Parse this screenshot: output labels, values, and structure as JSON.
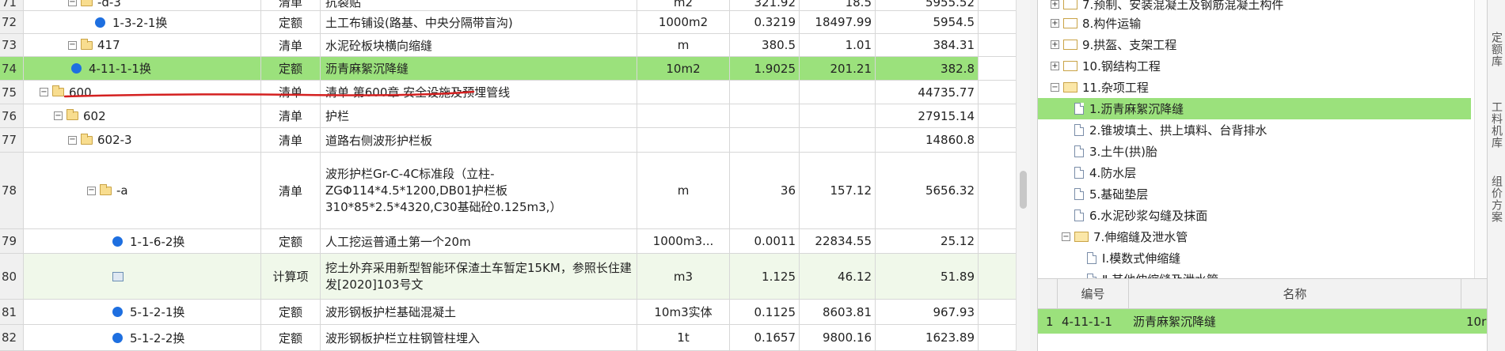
{
  "grid_rows": [
    {
      "num": "71",
      "code": "-d-3",
      "type": "清单",
      "name": "抗裂贴",
      "unit": "m2",
      "qty": "321.92",
      "price": "18.5",
      "total": "5955.52"
    },
    {
      "num": "72",
      "code": "1-3-2-1换",
      "type": "定额",
      "name": "土工布铺设(路基、中央分隔带盲沟)",
      "unit": "1000m2",
      "qty": "0.3219",
      "price": "18497.99",
      "total": "5954.5"
    },
    {
      "num": "73",
      "code": "417",
      "type": "清单",
      "name": "水泥砼板块横向缩缝",
      "unit": "m",
      "qty": "380.5",
      "price": "1.01",
      "total": "384.31"
    },
    {
      "num": "74",
      "code": "4-11-1-1换",
      "type": "定额",
      "name": "沥青麻絮沉降缝",
      "unit": "10m2",
      "qty": "1.9025",
      "price": "201.21",
      "total": "382.8"
    },
    {
      "num": "75",
      "code": "600",
      "type": "清单",
      "name": "清单  第600章  安全设施及预埋管线",
      "unit": "",
      "qty": "",
      "price": "",
      "total": "44735.77"
    },
    {
      "num": "76",
      "code": "602",
      "type": "清单",
      "name": "护栏",
      "unit": "",
      "qty": "",
      "price": "",
      "total": "27915.14"
    },
    {
      "num": "77",
      "code": "602-3",
      "type": "清单",
      "name": "道路右侧波形护栏板",
      "unit": "",
      "qty": "",
      "price": "",
      "total": "14860.8"
    },
    {
      "num": "78",
      "code": "-a",
      "type": "清单",
      "name": "波形护栏Gr-C-4C标准段（立柱-ZGΦ114*4.5*1200,DB01护栏板310*85*2.5*4320,C30基础砼0.125m3,）",
      "unit": "m",
      "qty": "36",
      "price": "157.12",
      "total": "5656.32"
    },
    {
      "num": "79",
      "code": "1-1-6-2换",
      "type": "定额",
      "name": "人工挖运普通土第一个20m",
      "unit": "1000m3...",
      "qty": "0.0011",
      "price": "22834.55",
      "total": "25.12"
    },
    {
      "num": "80",
      "code": "",
      "type": "计算项",
      "name": "挖土外弃采用新型智能环保渣土车暂定15KM，参照长住建发[2020]103号文",
      "unit": "m3",
      "qty": "1.125",
      "price": "46.12",
      "total": "51.89"
    },
    {
      "num": "81",
      "code": "5-1-2-1换",
      "type": "定额",
      "name": "波形钢板护栏基础混凝土",
      "unit": "10m3实体",
      "qty": "0.1125",
      "price": "8603.81",
      "total": "967.93"
    },
    {
      "num": "82",
      "code": "5-1-2-2换",
      "type": "定额",
      "name": "波形钢板护栏立柱钢管柱埋入",
      "unit": "1t",
      "qty": "0.1657",
      "price": "9800.16",
      "total": "1623.89"
    }
  ],
  "tree": [
    "7.预制、安装混凝土及钢筋混凝土构件",
    "8.构件运输",
    "9.拱盔、支架工程",
    "10.钢结构工程",
    "11.杂项工程",
    "1.沥青麻絮沉降缝",
    "2.锥坡填土、拱上填料、台背排水",
    "3.土牛(拱)胎",
    "4.防水层",
    "5.基础垫层",
    "6.水泥砂浆勾缝及抹面",
    "7.伸缩缝及泄水管",
    "Ⅰ.模数式伸缩缝",
    "Ⅱ.其他伸缩缝及泄水管"
  ],
  "bottom": {
    "header_code": "编号",
    "header_name": "名称",
    "row_num": "1",
    "row_code": "4-11-1-1",
    "row_name": "沥青麻絮沉降缝",
    "row_extra": "10r"
  },
  "side_tabs": [
    "定额库",
    "工料机库",
    "组价方案"
  ],
  "colors": {
    "selected": "#9be17c",
    "calc_row": "#f0f8ea",
    "dot": "#1e6fe0",
    "annotation": "#d42020"
  }
}
